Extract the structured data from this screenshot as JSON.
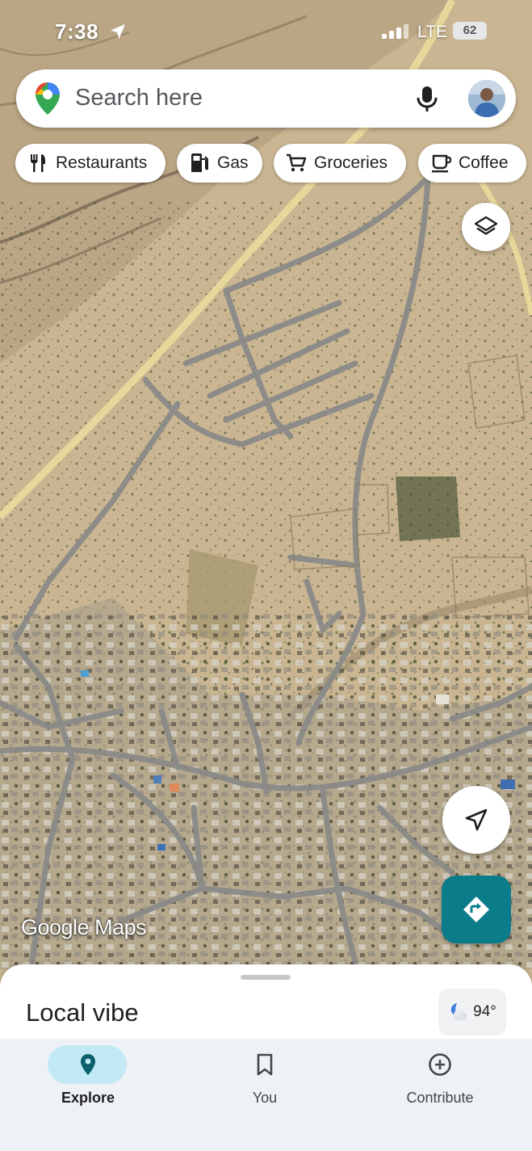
{
  "status_bar": {
    "time": "7:38",
    "network": "LTE",
    "battery": "62"
  },
  "search": {
    "placeholder": "Search here"
  },
  "chips": [
    {
      "label": "Restaurants",
      "icon": "fork-knife-icon"
    },
    {
      "label": "Gas",
      "icon": "gas-pump-icon"
    },
    {
      "label": "Groceries",
      "icon": "shopping-cart-icon"
    },
    {
      "label": "Coffee",
      "icon": "coffee-cup-icon"
    }
  ],
  "map": {
    "view": "satellite",
    "watermark_brand": "Google",
    "watermark_product": "Maps"
  },
  "buttons": {
    "layers_icon": "layers-icon",
    "location_icon": "navigation-arrow-icon",
    "directions_icon": "directions-icon",
    "directions_color": "#0a7c8a"
  },
  "sheet": {
    "title": "Local vibe",
    "weather_temp": "94°",
    "weather_icon": "partly-cloudy-night-icon"
  },
  "nav": {
    "items": [
      {
        "label": "Explore",
        "icon": "map-pin-icon",
        "active": true
      },
      {
        "label": "You",
        "icon": "bookmark-icon",
        "active": false
      },
      {
        "label": "Contribute",
        "icon": "plus-circle-icon",
        "active": false
      }
    ],
    "active_color": "#c2e9f4"
  }
}
